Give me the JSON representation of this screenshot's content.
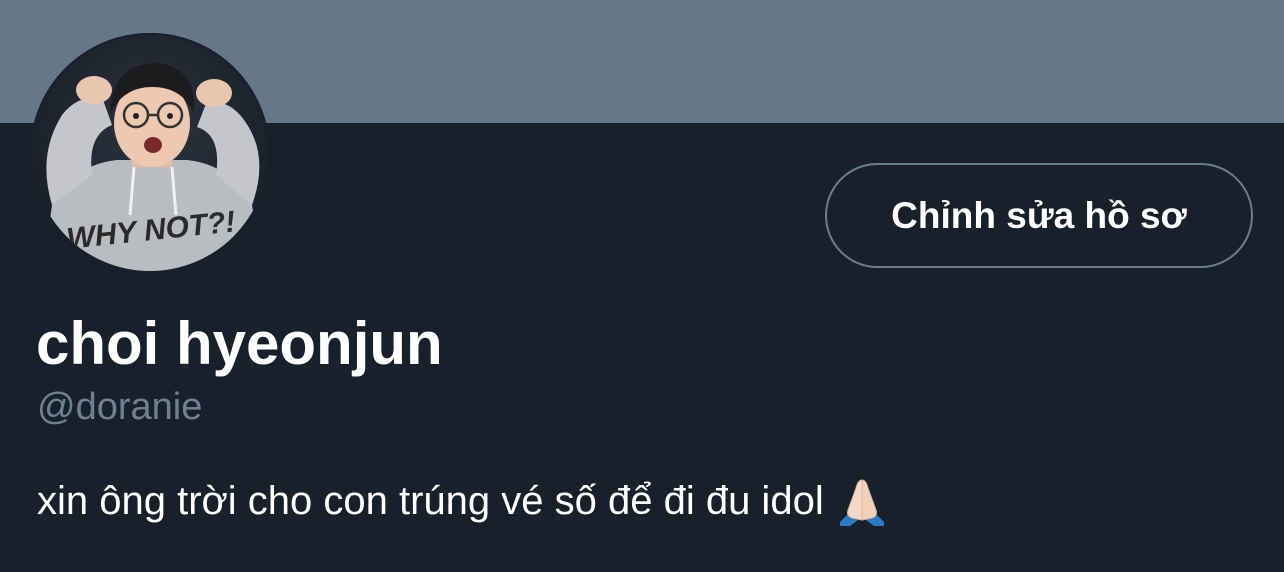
{
  "profile": {
    "display_name": "choi hyeonjun",
    "handle": "@doranie",
    "bio": "xin ông trời cho con trúng vé số để đi đu idol",
    "bio_emoji": "folded-hands-icon",
    "avatar_shirt_text": "WHY NOT?!"
  },
  "actions": {
    "edit_profile_label": "Chỉnh sửa hồ sơ"
  },
  "colors": {
    "banner": "#667888",
    "background": "#17202b",
    "handle_text": "#6f8191",
    "button_border": "#6b7e8f",
    "text": "#ffffff"
  }
}
